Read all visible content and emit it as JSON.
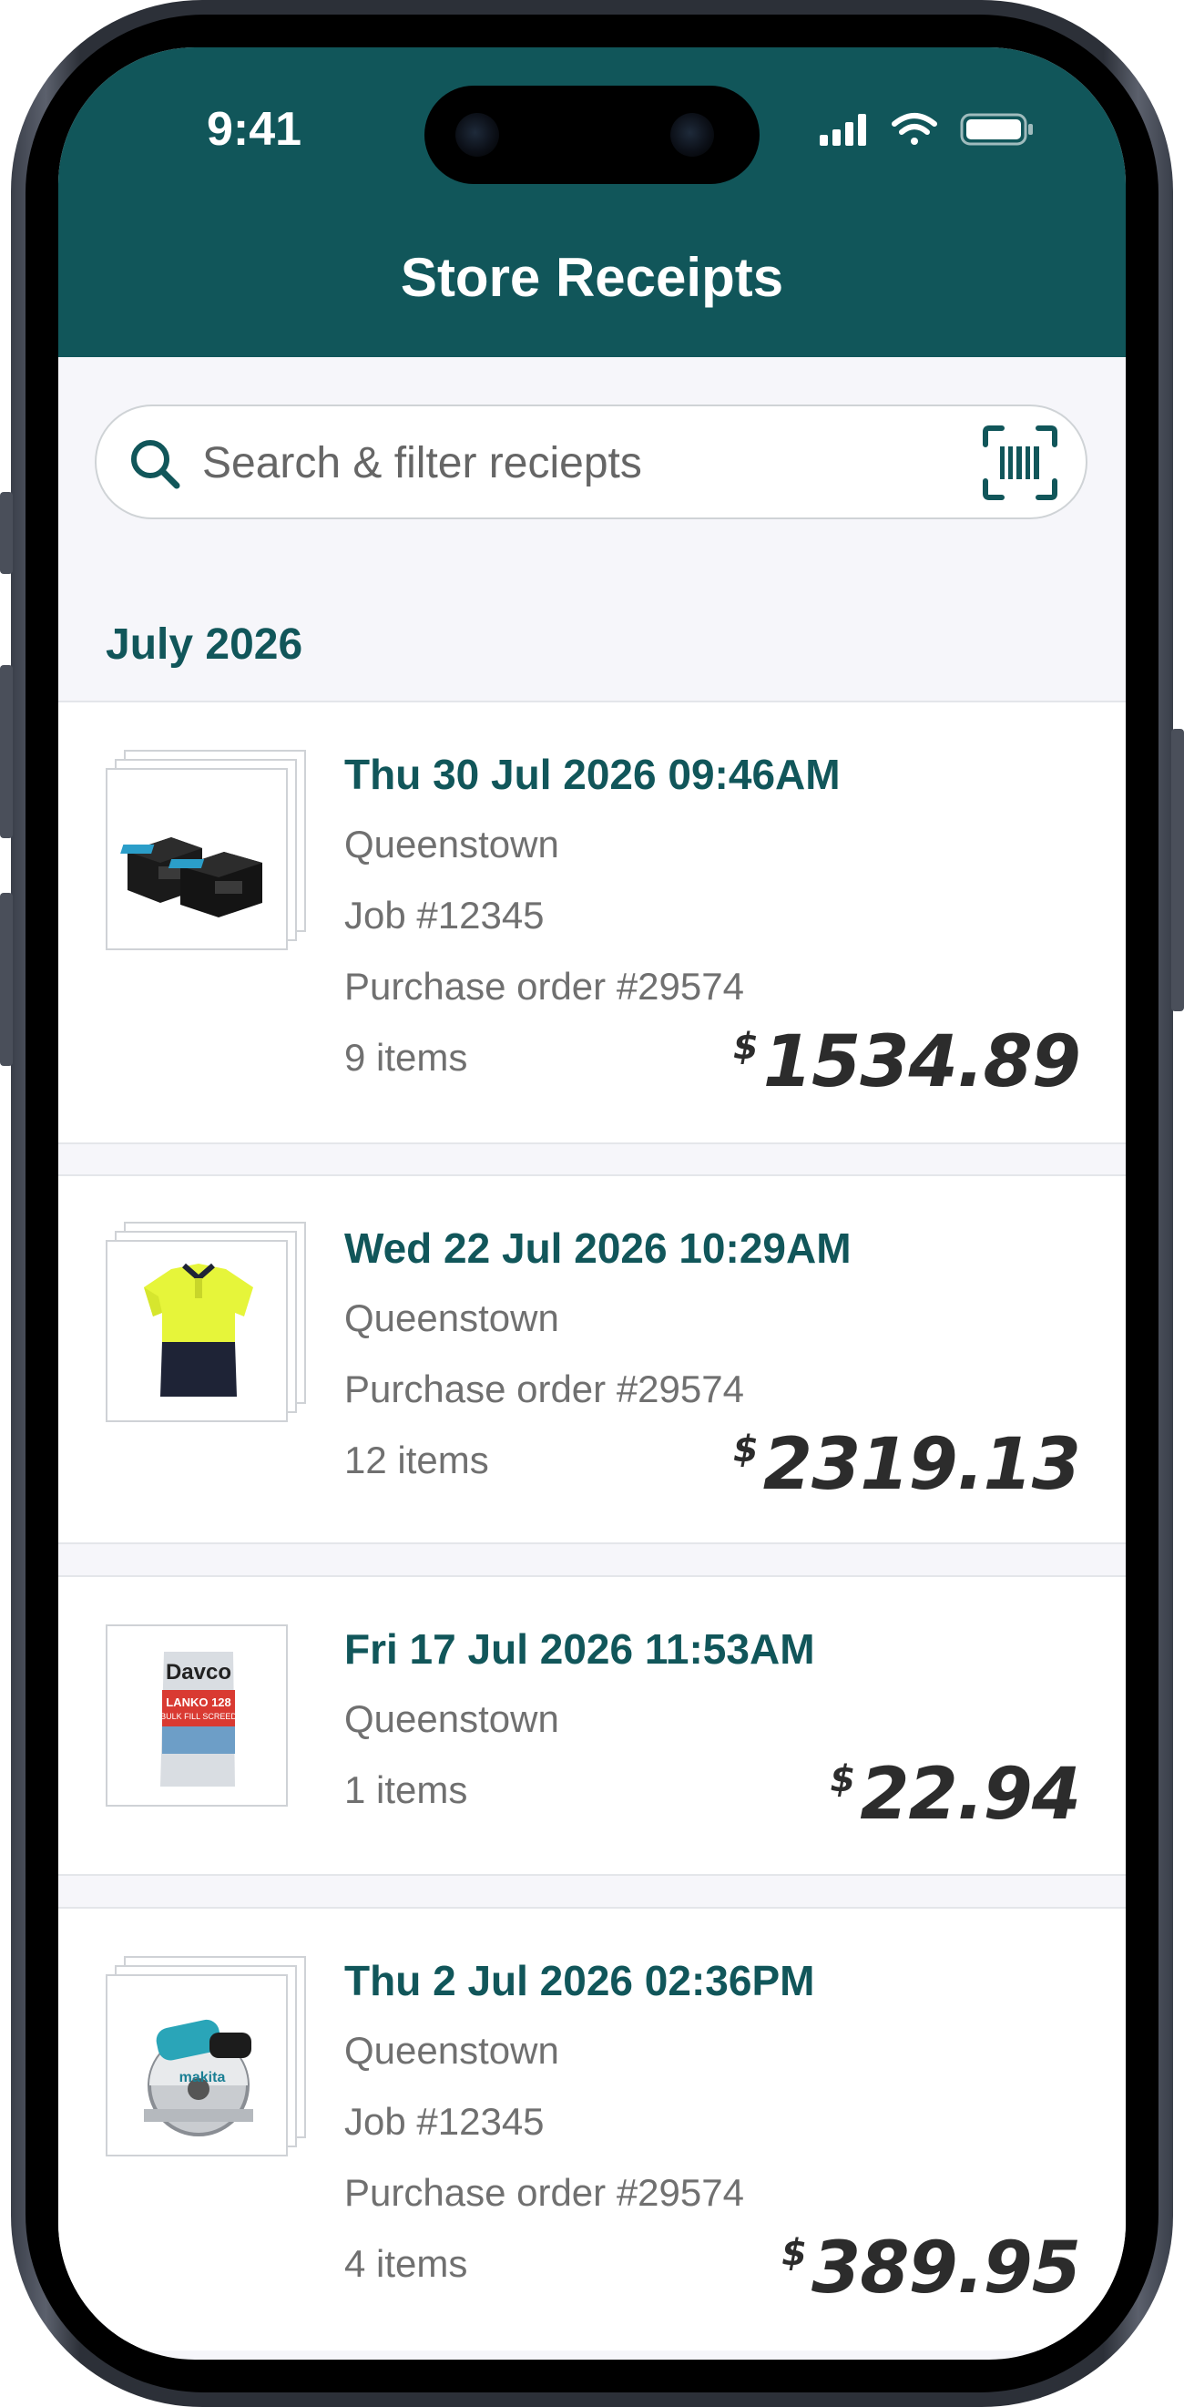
{
  "status_bar": {
    "time": "9:41"
  },
  "header": {
    "title": "Store Receipts"
  },
  "search": {
    "placeholder": "Search & filter reciepts"
  },
  "month_heading": "July 2026",
  "receipts": [
    {
      "date": "Thu 30 Jul 2026 09:46AM",
      "lines": [
        "Queenstown",
        "Job #12345",
        "Purchase order #29574",
        "9 items"
      ],
      "currency": "$",
      "amount": "1534.89",
      "thumbnail": "battery-packs-image"
    },
    {
      "date": "Wed 22 Jul 2026 10:29AM",
      "lines": [
        "Queenstown",
        "Purchase order #29574",
        "12 items"
      ],
      "currency": "$",
      "amount": "2319.13",
      "thumbnail": "hi-vis-polo-shirt-image"
    },
    {
      "date": "Fri 17 Jul 2026 11:53AM",
      "lines": [
        "Queenstown",
        "1 items"
      ],
      "currency": "$",
      "amount": "22.94",
      "thumbnail": "cement-bag-image",
      "thumbnail_text": [
        "Davco",
        "LANKO 128",
        "BULK FILL SCREED"
      ]
    },
    {
      "date": "Thu 2 Jul 2026 02:36PM",
      "lines": [
        "Queenstown",
        "Job #12345",
        "Purchase order #29574",
        "4 items"
      ],
      "currency": "$",
      "amount": "389.95",
      "thumbnail": "circular-saw-image",
      "thumbnail_text": [
        "makita"
      ]
    }
  ],
  "colors": {
    "header": "#11565a",
    "accent": "#11565a",
    "background": "#f6f6fa"
  }
}
